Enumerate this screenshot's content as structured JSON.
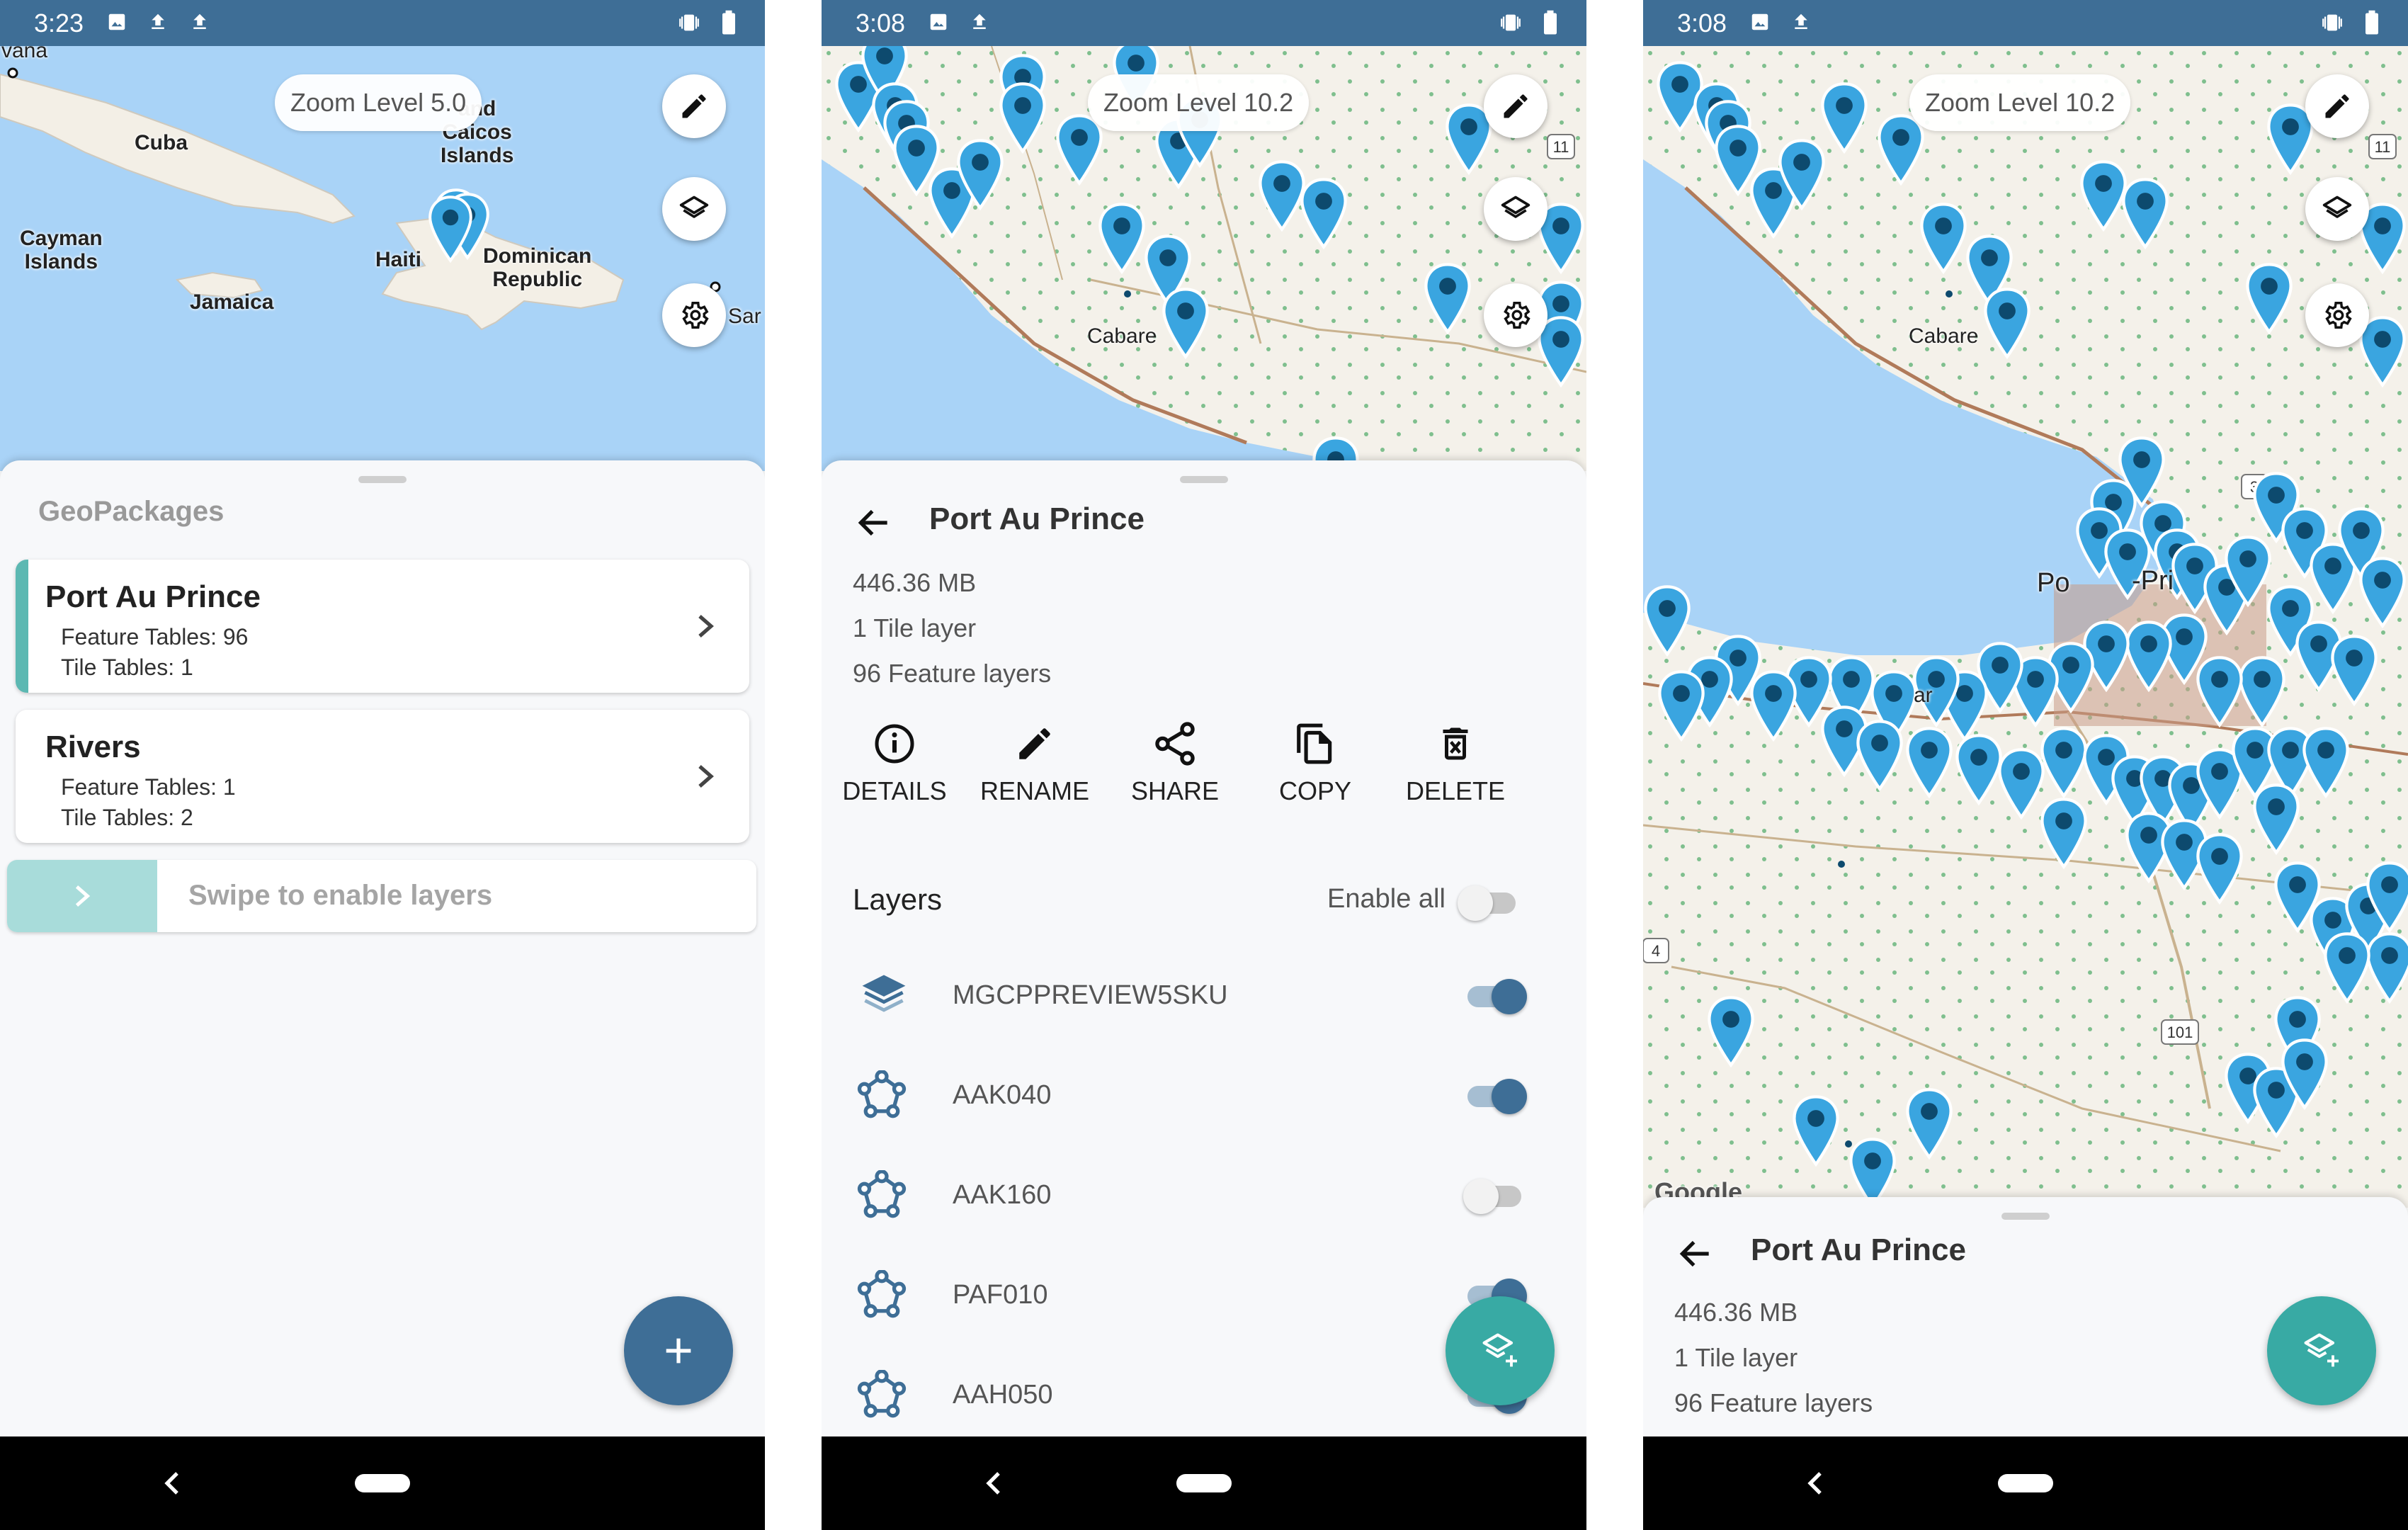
{
  "colors": {
    "status_bar": "#3e6e96",
    "accent_teal": "#38aaa4",
    "marker_blue": "#3aa5e0",
    "map_water": "#a9d3f7",
    "toggle_on": "#3e6e96"
  },
  "screen1": {
    "status": {
      "time": "3:23",
      "left_icons": [
        "image-icon",
        "upload-icon",
        "upload-icon"
      ],
      "right_icons": [
        "vibrate-icon",
        "battery-icon"
      ]
    },
    "map": {
      "zoom_label": "Zoom Level 5.0",
      "labels": [
        "Cuba",
        "and\nCaicos\nIslands",
        "Cayman\nIslands",
        "Jamaica",
        "Haiti",
        "Dominican\nRepublic",
        "Sar",
        "vana"
      ]
    },
    "sheet": {
      "header": "GeoPackages",
      "items": [
        {
          "name": "Port Au Prince",
          "feature_tables": "Feature Tables: 96",
          "tile_tables": "Tile Tables: 1"
        },
        {
          "name": "Rivers",
          "feature_tables": "Feature Tables: 1",
          "tile_tables": "Tile Tables: 2"
        }
      ],
      "swipe_label": "Swipe to enable layers"
    },
    "fab_icon": "plus-icon"
  },
  "screen2": {
    "status": {
      "time": "3:08",
      "left_icons": [
        "image-icon",
        "upload-icon"
      ],
      "right_icons": [
        "vibrate-icon",
        "battery-icon"
      ]
    },
    "map": {
      "zoom_label": "Zoom Level 10.2",
      "labels": [
        "Cabare"
      ],
      "road_shield": "11"
    },
    "detail": {
      "title": "Port Au Prince",
      "size": "446.36 MB",
      "tile_layers": "1 Tile layer",
      "feature_layers": "96 Feature layers",
      "actions": [
        {
          "label": "DETAILS",
          "icon": "info-icon"
        },
        {
          "label": "RENAME",
          "icon": "pencil-icon"
        },
        {
          "label": "SHARE",
          "icon": "share-icon"
        },
        {
          "label": "COPY",
          "icon": "copy-icon"
        },
        {
          "label": "DELETE",
          "icon": "delete-icon"
        }
      ],
      "layers_title": "Layers",
      "enable_all": "Enable all",
      "enable_all_on": false,
      "layers": [
        {
          "name": "MGCPPREVIEW5SKU",
          "icon": "tile-layers-icon",
          "enabled": true
        },
        {
          "name": "AAK040",
          "icon": "polygon-icon",
          "enabled": true
        },
        {
          "name": "AAK160",
          "icon": "polygon-icon",
          "enabled": false
        },
        {
          "name": "PAF010",
          "icon": "polygon-icon",
          "enabled": true
        },
        {
          "name": "AAH050",
          "icon": "polygon-icon",
          "enabled": true
        }
      ]
    },
    "fab_icon": "add-layer-icon"
  },
  "screen3": {
    "status": {
      "time": "3:08",
      "left_icons": [
        "image-icon",
        "upload-icon"
      ],
      "right_icons": [
        "vibrate-icon",
        "battery-icon"
      ]
    },
    "map": {
      "zoom_label": "Zoom Level 10.2",
      "labels": [
        "Cabare",
        "Po",
        "-Pri",
        "ar"
      ],
      "road_shields": [
        "11",
        "3",
        "4",
        "101"
      ],
      "attribution": "Google"
    },
    "detail": {
      "title": "Port Au Prince",
      "size": "446.36 MB",
      "tile_layers": "1 Tile layer",
      "feature_layers": "96 Feature layers"
    },
    "fab_icon": "add-layer-icon"
  }
}
